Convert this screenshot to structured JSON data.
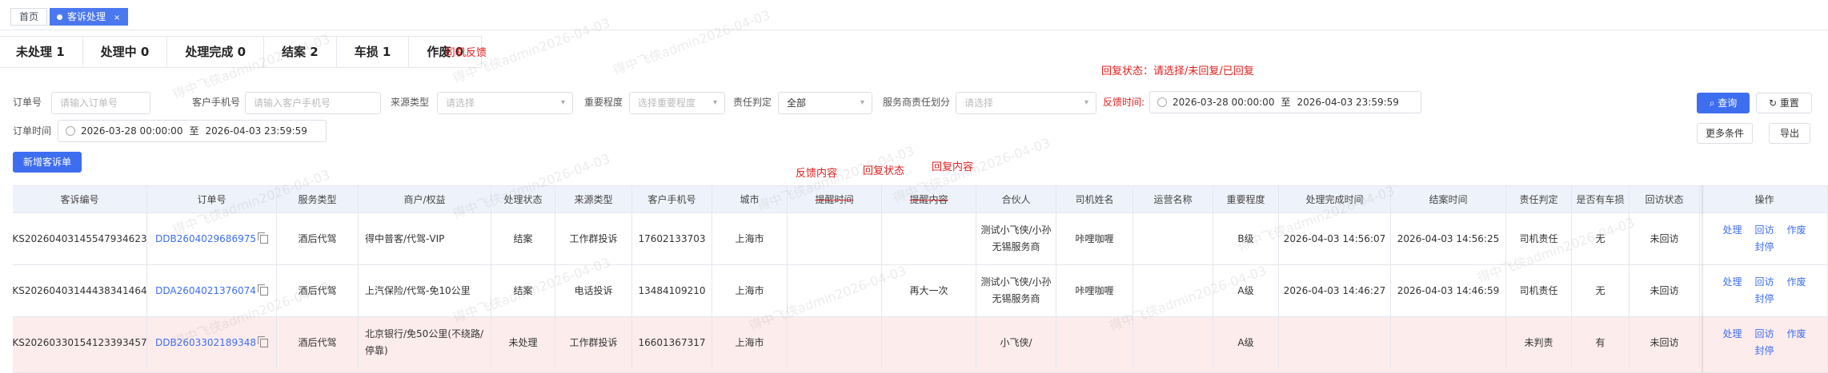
{
  "tabs": {
    "home": "首页",
    "active": "客诉处理",
    "close": "×"
  },
  "status_tabs": [
    "未处理 1",
    "处理中 0",
    "处理完成 0",
    "结案 2",
    "车损 1",
    "作废 0"
  ],
  "notes": {
    "feedback": "司机反馈",
    "reply_status": "回复状态：请选择/未回复/已回复"
  },
  "filters": {
    "order_no": {
      "label": "订单号",
      "placeholder": "请输入订单号"
    },
    "phone": {
      "label": "客户手机号",
      "placeholder": "请输入客户手机号"
    },
    "source": {
      "label": "来源类型",
      "placeholder": "请选择"
    },
    "importance": {
      "label": "重要程度",
      "placeholder": "选择重要程度"
    },
    "responsibility": {
      "label": "责任判定",
      "value": "全部"
    },
    "provider_resp": {
      "label": "服务商责任划分",
      "placeholder": "请选择"
    },
    "feedback_time": {
      "label": "反馈时间:",
      "start": "2026-03-28 00:00:00",
      "sep": "至",
      "end": "2026-04-03 23:59:59"
    },
    "order_time": {
      "label": "订单时间",
      "start": "2026-03-28 00:00:00",
      "sep": "至",
      "end": "2026-04-03 23:59:59"
    }
  },
  "buttons": {
    "search": "查询",
    "reset": "重置",
    "new": "新增客诉单",
    "more": "更多条件",
    "export": "导出"
  },
  "overlays": {
    "feedback_content": "反馈内容",
    "reply_status": "回复状态",
    "reply_content": "回复内容"
  },
  "table": {
    "headers": [
      "客诉编号",
      "订单号",
      "服务类型",
      "商户/权益",
      "处理状态",
      "来源类型",
      "客户手机号",
      "城市",
      "提醒时间",
      "提醒内容",
      "合伙人",
      "司机姓名",
      "运营名称",
      "重要程度",
      "处理完成时间",
      "结案时间",
      "责任判定",
      "是否有车损",
      "回访状态",
      "操作"
    ],
    "rows": [
      {
        "id": "KS20260403145547934623",
        "order": "DDB2604029686975",
        "service": "酒后代驾",
        "merchant": "得中普客/代驾-VIP",
        "status": "结案",
        "source": "工作群投诉",
        "phone": "17602133703",
        "city": "上海市",
        "remind_time": "",
        "remind": "",
        "partner": "测试小飞侠/小孙无锡服务商",
        "driver": "咔哩咖喱",
        "ops": "",
        "level": "B级",
        "done_time": "2026-04-03 14:56:07",
        "close_time": "2026-04-03 14:56:25",
        "resp": "司机责任",
        "damage": "无",
        "visit": "未回访",
        "ops_links": [
          "处理",
          "回访",
          "作废",
          "封停"
        ]
      },
      {
        "id": "KS20260403144438341464",
        "order": "DDA2604021376074",
        "service": "酒后代驾",
        "merchant": "上汽保险/代驾-免10公里",
        "status": "结案",
        "source": "电话投诉",
        "phone": "13484109210",
        "city": "上海市",
        "remind_time": "",
        "remind": "再大一次",
        "partner": "测试小飞侠/小孙无锡服务商",
        "driver": "咔哩咖喱",
        "ops": "",
        "level": "A级",
        "done_time": "2026-04-03 14:46:27",
        "close_time": "2026-04-03 14:46:59",
        "resp": "司机责任",
        "damage": "无",
        "visit": "未回访",
        "ops_links": [
          "处理",
          "回访",
          "作废",
          "封停"
        ]
      },
      {
        "id": "KS20260330154123393457",
        "order": "DDB2603302189348",
        "service": "酒后代驾",
        "merchant": "北京银行/免50公里(不绕路/停靠)",
        "status": "未处理",
        "source": "工作群投诉",
        "phone": "16601367317",
        "city": "上海市",
        "remind_time": "",
        "remind": "",
        "partner": "小飞侠/",
        "driver": "",
        "ops": "",
        "level": "A级",
        "done_time": "",
        "close_time": "",
        "resp": "未判责",
        "damage": "有",
        "visit": "未回访",
        "ops_links": [
          "处理",
          "回访",
          "作废",
          "封停"
        ]
      }
    ]
  },
  "watermark": "得中飞侠admin2026-04-03",
  "colors": {
    "primary": "#3e6ef0",
    "annotation": "#e02020",
    "highlight_row": "#fdecec"
  }
}
